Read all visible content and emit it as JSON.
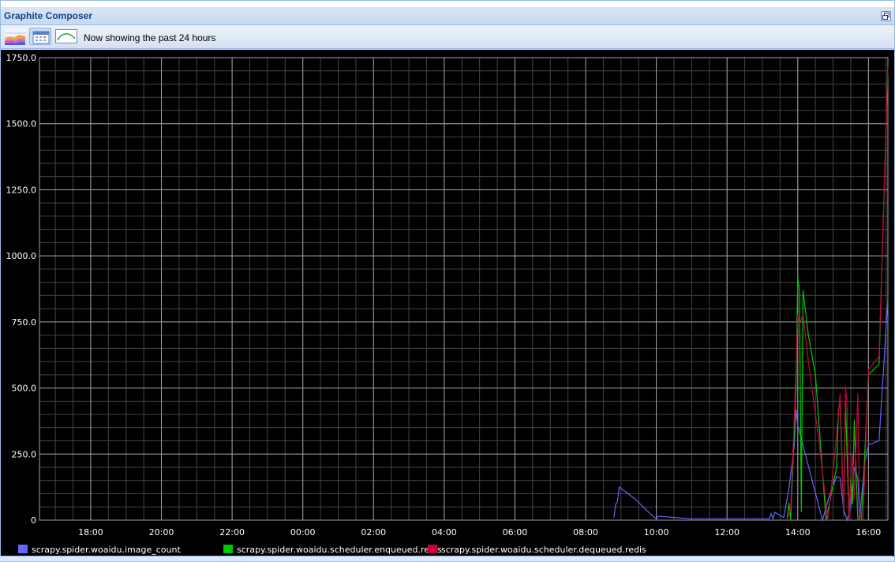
{
  "window": {
    "title": "Graphite Composer"
  },
  "toolbar": {
    "buttons": [
      {
        "icon": "area-chart-icon",
        "active": false
      },
      {
        "icon": "calendar-icon",
        "active": true
      },
      {
        "icon": "curve-options-icon",
        "active": false
      }
    ],
    "status_text": "Now showing the past 24 hours"
  },
  "chart_data": {
    "type": "line",
    "title": "",
    "xlabel": "",
    "ylabel": "",
    "background": "#000000",
    "grid": true,
    "legend_position": "bottom",
    "x_ticks": [
      "18:00",
      "20:00",
      "22:00",
      "00:00",
      "02:00",
      "04:00",
      "06:00",
      "08:00",
      "10:00",
      "12:00",
      "14:00",
      "16:00"
    ],
    "y_ticks": [
      "0",
      "250.0",
      "500.0",
      "750.0",
      "1000.0",
      "1250.0",
      "1500.0",
      "1750.0"
    ],
    "ylim": [
      0,
      1750
    ],
    "xlim_hours": [
      16.55,
      40.55
    ],
    "series": [
      {
        "name": "scrapy.spider.woaidu.image_count",
        "color": "#6464ff",
        "points": [
          [
            32.8,
            10
          ],
          [
            32.85,
            60
          ],
          [
            32.9,
            70
          ],
          [
            32.95,
            125
          ],
          [
            33.4,
            80
          ],
          [
            33.9,
            15
          ],
          [
            34.0,
            5
          ],
          [
            34.05,
            15
          ],
          [
            35.0,
            5
          ],
          [
            37.2,
            5
          ],
          [
            37.25,
            25
          ],
          [
            37.3,
            5
          ],
          [
            37.35,
            30
          ],
          [
            37.6,
            10
          ],
          [
            37.75,
            120
          ],
          [
            37.9,
            280
          ],
          [
            37.95,
            420
          ],
          [
            38.0,
            360
          ],
          [
            38.7,
            0
          ],
          [
            38.9,
            95
          ],
          [
            39.1,
            165
          ],
          [
            39.2,
            160
          ],
          [
            39.3,
            40
          ],
          [
            39.4,
            0
          ],
          [
            39.5,
            55
          ],
          [
            39.6,
            200
          ],
          [
            39.7,
            160
          ],
          [
            39.75,
            0
          ],
          [
            39.8,
            80
          ],
          [
            39.9,
            220
          ],
          [
            40.0,
            285
          ],
          [
            40.3,
            300
          ],
          [
            40.55,
            840
          ]
        ]
      },
      {
        "name": "scrapy.spider.woaidu.scheduler.enqueued.redis",
        "color": "#00c800",
        "points": [
          [
            37.7,
            0
          ],
          [
            37.75,
            65
          ],
          [
            37.8,
            0
          ],
          [
            37.95,
            500
          ],
          [
            38.0,
            920
          ],
          [
            38.05,
            870
          ],
          [
            38.1,
            30
          ],
          [
            38.15,
            870
          ],
          [
            38.3,
            700
          ],
          [
            38.5,
            550
          ],
          [
            38.8,
            0
          ],
          [
            39.1,
            200
          ],
          [
            39.15,
            420
          ],
          [
            39.2,
            440
          ],
          [
            39.3,
            20
          ],
          [
            39.35,
            450
          ],
          [
            39.45,
            0
          ],
          [
            39.5,
            160
          ],
          [
            39.55,
            60
          ],
          [
            39.6,
            380
          ],
          [
            39.7,
            0
          ],
          [
            39.8,
            0
          ],
          [
            39.85,
            120
          ],
          [
            40.0,
            550
          ],
          [
            40.3,
            590
          ],
          [
            40.55,
            1725
          ]
        ]
      },
      {
        "name": "scrapy.spider.woaidu.scheduler.dequeued.redis",
        "color": "#c8003c",
        "points": [
          [
            37.7,
            0
          ],
          [
            37.8,
            45
          ],
          [
            37.9,
            380
          ],
          [
            38.0,
            780
          ],
          [
            38.05,
            740
          ],
          [
            38.15,
            780
          ],
          [
            38.3,
            600
          ],
          [
            38.6,
            300
          ],
          [
            38.85,
            0
          ],
          [
            39.05,
            250
          ],
          [
            39.2,
            480
          ],
          [
            39.3,
            10
          ],
          [
            39.35,
            510
          ],
          [
            39.4,
            420
          ],
          [
            39.45,
            0
          ],
          [
            39.55,
            250
          ],
          [
            39.6,
            80
          ],
          [
            39.7,
            480
          ],
          [
            39.75,
            20
          ],
          [
            39.85,
            0
          ],
          [
            39.95,
            390
          ],
          [
            40.0,
            570
          ],
          [
            40.3,
            620
          ],
          [
            40.55,
            1715
          ]
        ]
      }
    ]
  }
}
